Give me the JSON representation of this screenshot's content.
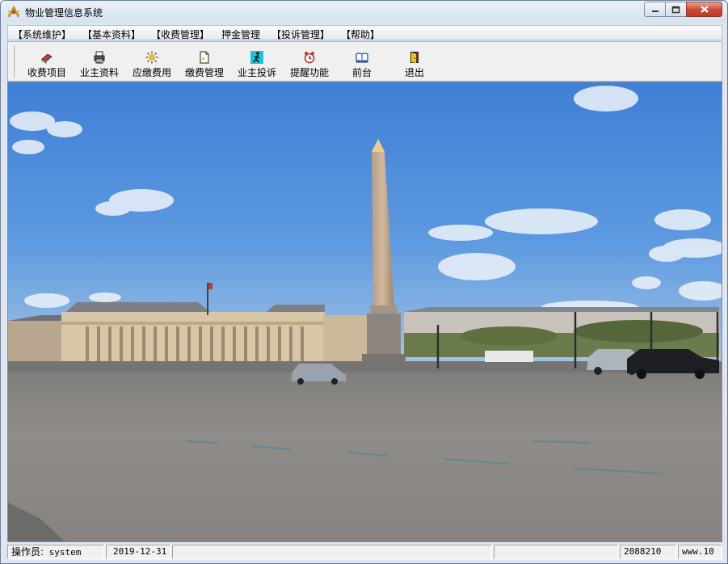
{
  "window": {
    "title": "物业管理信息系统",
    "icon": "app-logo-icon"
  },
  "caption_buttons": [
    {
      "name": "minimize-button",
      "icon": "minimize-icon"
    },
    {
      "name": "maximize-button",
      "icon": "maximize-icon"
    },
    {
      "name": "close-button",
      "icon": "close-icon"
    }
  ],
  "menu": [
    {
      "label": "【系统维护】"
    },
    {
      "label": "【基本资料】"
    },
    {
      "label": "【收费管理】"
    },
    {
      "label": "押金管理"
    },
    {
      "label": "【投诉管理】"
    },
    {
      "label": "【帮助】"
    }
  ],
  "toolbar": [
    {
      "label": "收费项目",
      "icon": "eraser-icon"
    },
    {
      "label": "业主资料",
      "icon": "printer-icon"
    },
    {
      "label": "应缴费用",
      "icon": "sun-icon"
    },
    {
      "label": "缴费管理",
      "icon": "document-icon"
    },
    {
      "label": "业主投诉",
      "icon": "walking-person-icon"
    },
    {
      "label": "提醒功能",
      "icon": "alarm-clock-icon"
    },
    {
      "label": "前台",
      "icon": "open-book-icon"
    },
    {
      "label": "退出",
      "icon": "exit-door-icon"
    }
  ],
  "background_image": "place-de-la-concorde-obelisk-photo",
  "status": {
    "operator_label": "操作员:",
    "operator_value": "system",
    "date": "2019-12-31",
    "code": "2088210",
    "site": "www.10"
  },
  "colors": {
    "sky_top": "#3f7fd6",
    "sky_bottom": "#a9c6e6",
    "ground": "#8d8a86",
    "close_red": "#c9482f"
  }
}
